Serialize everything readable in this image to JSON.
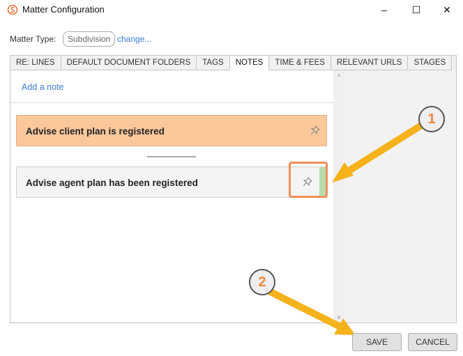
{
  "window": {
    "title": "Matter Configuration",
    "controls": {
      "minimize": "–",
      "maximize": "☐",
      "close": "✕"
    }
  },
  "matter_type": {
    "label": "Matter Type:",
    "value": "Subdivision",
    "change_link": "change..."
  },
  "tabs": [
    {
      "label": "RE: LINES"
    },
    {
      "label": "DEFAULT DOCUMENT FOLDERS"
    },
    {
      "label": "TAGS"
    },
    {
      "label": "NOTES",
      "active": true
    },
    {
      "label": "TIME & FEES"
    },
    {
      "label": "RELEVANT URLS"
    },
    {
      "label": "STAGES"
    }
  ],
  "notes": {
    "add_note": "Add a note",
    "items": [
      {
        "text": "Advise client plan is registered",
        "color": "#fbc89c"
      },
      {
        "text": "Advise agent plan has been registered",
        "color": "#f4f4f4"
      }
    ]
  },
  "scroll": {
    "up": "^",
    "down": "v"
  },
  "callouts": {
    "one": "1",
    "two": "2"
  },
  "footer": {
    "save": "SAVE",
    "cancel": "CANCEL"
  },
  "colors": {
    "accent_link": "#3a7bd5",
    "highlight": "#ef8f5a",
    "arrow": "#f5b21b"
  }
}
